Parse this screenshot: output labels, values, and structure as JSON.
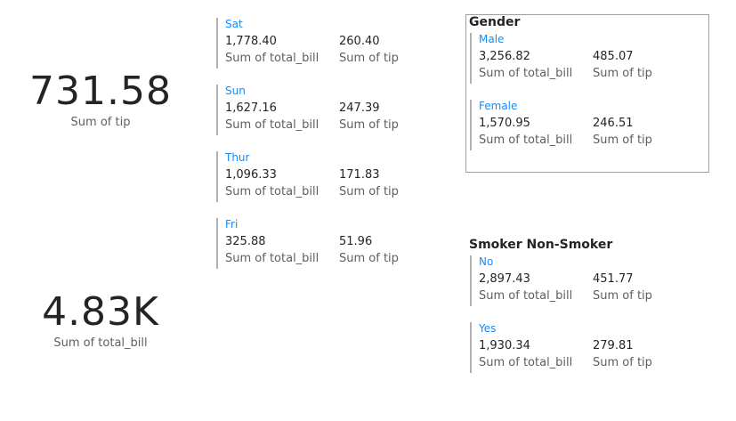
{
  "tip_card": {
    "value": "731.58",
    "label": "Sum of tip"
  },
  "bill_card": {
    "value": "4.83K",
    "label": "Sum of total_bill"
  },
  "days": [
    {
      "name": "Sat",
      "total_bill": "1,778.40",
      "tip": "260.40",
      "bill_label": "Sum of total_bill",
      "tip_label": "Sum of tip"
    },
    {
      "name": "Sun",
      "total_bill": "1,627.16",
      "tip": "247.39",
      "bill_label": "Sum of total_bill",
      "tip_label": "Sum of tip"
    },
    {
      "name": "Thur",
      "total_bill": "1,096.33",
      "tip": "171.83",
      "bill_label": "Sum of total_bill",
      "tip_label": "Sum of tip"
    },
    {
      "name": "Fri",
      "total_bill": "325.88",
      "tip": "51.96",
      "bill_label": "Sum of total_bill",
      "tip_label": "Sum of tip"
    }
  ],
  "gender": {
    "title": "Gender",
    "items": [
      {
        "name": "Male",
        "total_bill": "3,256.82",
        "tip": "485.07",
        "bill_label": "Sum of total_bill",
        "tip_label": "Sum of tip"
      },
      {
        "name": "Female",
        "total_bill": "1,570.95",
        "tip": "246.51",
        "bill_label": "Sum of total_bill",
        "tip_label": "Sum of tip"
      }
    ]
  },
  "smoker": {
    "title": "Smoker Non-Smoker",
    "items": [
      {
        "name": "No",
        "total_bill": "2,897.43",
        "tip": "451.77",
        "bill_label": "Sum of total_bill",
        "tip_label": "Sum of tip"
      },
      {
        "name": "Yes",
        "total_bill": "1,930.34",
        "tip": "279.81",
        "bill_label": "Sum of total_bill",
        "tip_label": "Sum of tip"
      }
    ]
  },
  "colors": {
    "category": "#118dff",
    "text": "#252423",
    "label": "#605e5c",
    "bar": "#b3b0ad",
    "border": "#a19f9d"
  }
}
